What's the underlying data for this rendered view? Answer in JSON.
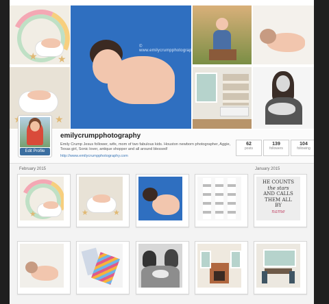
{
  "profile": {
    "username": "emilycrumpphotography",
    "bio": "Emily Crump Jesus follower, wife, mom of two fabulous kids. Houston newborn photographer, Aggie, Texas girl, Sonic lover, antique shopper and all around blessed!",
    "link": "http://www.emilycrumpphotography.com",
    "edit_label": "Edit Profile"
  },
  "stats": [
    {
      "number": "62",
      "label": "posts"
    },
    {
      "number": "139",
      "label": "followers"
    },
    {
      "number": "104",
      "label": "following"
    }
  ],
  "mosaic": {
    "watermark": "© www.emilycrumpphotography.com"
  },
  "months": {
    "left": "February 2015",
    "right": "January 2015"
  },
  "quote": [
    "HE COUNTS",
    "the stars",
    "AND CALLS",
    "THEM ALL",
    "BY",
    "name"
  ],
  "colors": {
    "accent": "#3b6ea0",
    "blanket": "#2f6fc0",
    "link": "#3a77b7"
  }
}
